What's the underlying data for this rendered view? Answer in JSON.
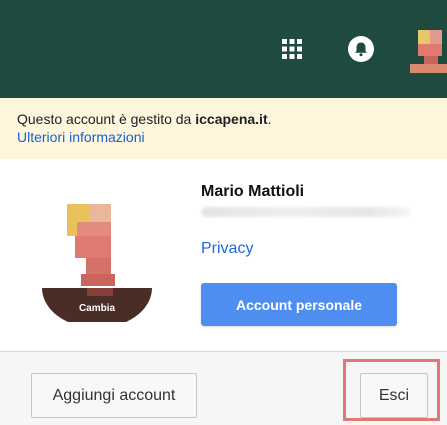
{
  "header": {
    "background_color": "#1e4a40",
    "icons": [
      "apps-grid-icon",
      "notifications-bell-icon",
      "account-avatar"
    ]
  },
  "managed_notice": {
    "text_prefix": "Questo account è gestito da ",
    "domain": "iccapena.it",
    "text_suffix": ".",
    "learn_more_link": "Ulteriori informazioni"
  },
  "profile": {
    "change_photo_label": "Cambia",
    "name": "Mario Mattioli",
    "privacy_link": "Privacy",
    "account_button_label": "Account personale",
    "account_button_color": "#4d8ef0"
  },
  "footer": {
    "add_account_label": "Aggiungi account",
    "sign_out_label": "Esci",
    "highlight_color": "#e07a70"
  }
}
